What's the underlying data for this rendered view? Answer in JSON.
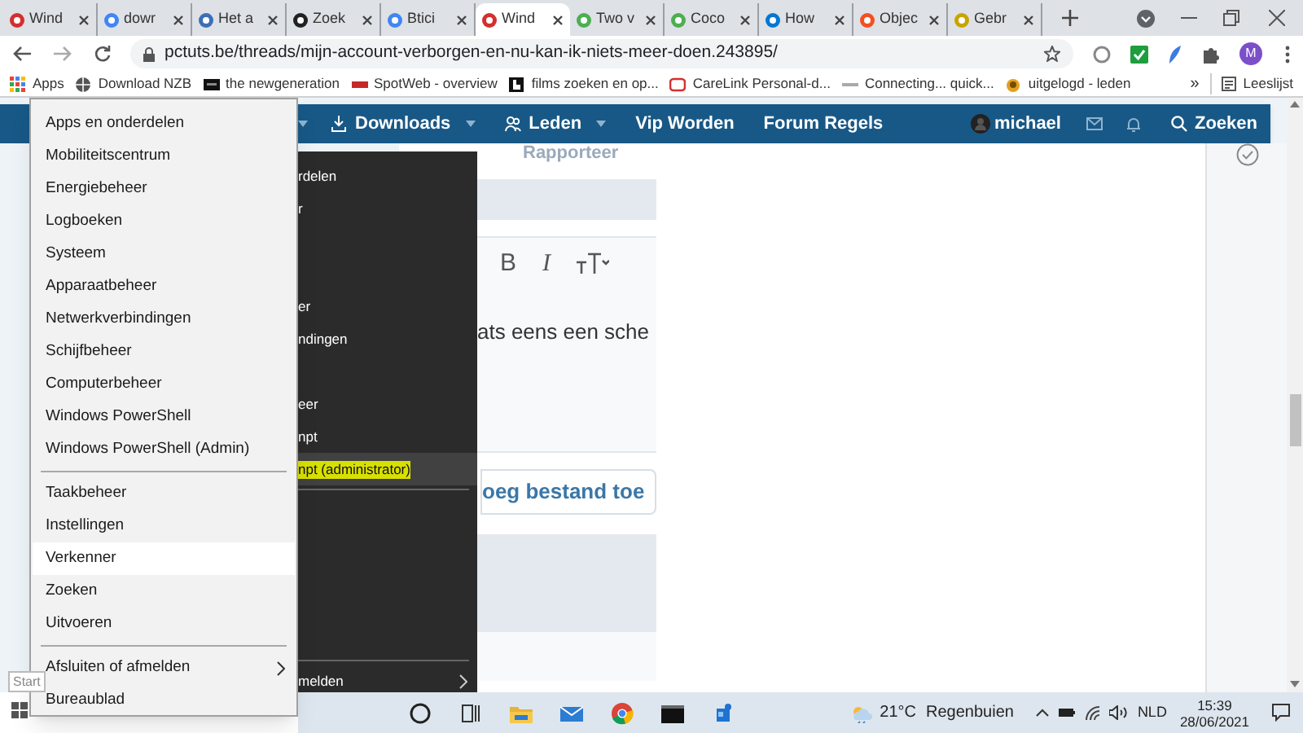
{
  "browser": {
    "tabs": [
      {
        "title": "Wind",
        "selected": false,
        "color": "#d32f2f"
      },
      {
        "title": "dowr",
        "selected": false,
        "color": "#4285f4"
      },
      {
        "title": "Het a",
        "selected": false,
        "color": "#3b6fb6"
      },
      {
        "title": "Zoek",
        "selected": false,
        "color": "#222222"
      },
      {
        "title": "Btici",
        "selected": false,
        "color": "#4285f4"
      },
      {
        "title": "Wind",
        "selected": true,
        "color": "#d32f2f"
      },
      {
        "title": "Two v",
        "selected": false,
        "color": "#4caf50"
      },
      {
        "title": "Coco",
        "selected": false,
        "color": "#4caf50"
      },
      {
        "title": "How",
        "selected": false,
        "color": "#0078d4"
      },
      {
        "title": "Objec",
        "selected": false,
        "color": "#f25022"
      },
      {
        "title": "Gebr",
        "selected": false,
        "color": "#c8a400"
      }
    ],
    "url": "pctuts.be/threads/mijn-account-verborgen-en-nu-kan-ik-niets-meer-doen.243895/",
    "profile_initial": "M",
    "bookmarks": [
      {
        "label": "Apps"
      },
      {
        "label": "Download NZB"
      },
      {
        "label": "the newgeneration"
      },
      {
        "label": "SpotWeb - overview"
      },
      {
        "label": "films zoeken en op..."
      },
      {
        "label": "CareLink Personal-d..."
      },
      {
        "label": "Connecting... quick..."
      },
      {
        "label": "uitgelogd - leden"
      }
    ],
    "bookmarks_overflow": "»",
    "reading_list": "Leeslijst"
  },
  "site_nav": {
    "items": [
      {
        "label": "Downloads",
        "dropdown": true
      },
      {
        "label": "Leden",
        "dropdown": true
      },
      {
        "label": "Vip Worden",
        "dropdown": false
      },
      {
        "label": "Forum Regels",
        "dropdown": false
      }
    ],
    "user": "michael",
    "search": "Zoeken"
  },
  "page": {
    "heading_fragment": "Rapporteer",
    "editor_buttons": [
      "B",
      "I"
    ],
    "editor_text": "ats eens een sche",
    "attach_button": "oeg bestand toe"
  },
  "context_menu": {
    "groups": [
      [
        {
          "label": "Apps en onderdelen",
          "selected": false,
          "submenu": false
        },
        {
          "label": "Mobiliteitscentrum",
          "selected": false,
          "submenu": false
        },
        {
          "label": "Energiebeheer",
          "selected": false,
          "submenu": false
        },
        {
          "label": "Logboeken",
          "selected": false,
          "submenu": false
        },
        {
          "label": "Systeem",
          "selected": false,
          "submenu": false
        },
        {
          "label": "Apparaatbeheer",
          "selected": false,
          "submenu": false
        },
        {
          "label": "Netwerkverbindingen",
          "selected": false,
          "submenu": false
        },
        {
          "label": "Schijfbeheer",
          "selected": false,
          "submenu": false
        },
        {
          "label": "Computerbeheer",
          "selected": false,
          "submenu": false
        },
        {
          "label": "Windows PowerShell",
          "selected": false,
          "submenu": false
        },
        {
          "label": "Windows PowerShell (Admin)",
          "selected": false,
          "submenu": false
        }
      ],
      [
        {
          "label": "Taakbeheer",
          "selected": false,
          "submenu": false
        },
        {
          "label": "Instellingen",
          "selected": false,
          "submenu": false
        },
        {
          "label": "Verkenner",
          "selected": true,
          "submenu": false
        },
        {
          "label": "Zoeken",
          "selected": false,
          "submenu": false
        },
        {
          "label": "Uitvoeren",
          "selected": false,
          "submenu": false
        }
      ],
      [
        {
          "label": "Afsluiten of afmelden",
          "selected": false,
          "submenu": true
        },
        {
          "label": "Bureaublad",
          "selected": false,
          "submenu": false
        }
      ]
    ]
  },
  "dark_menu": {
    "groups": [
      [
        {
          "kind": "text",
          "label": "rdelen",
          "highlighted": false
        },
        {
          "kind": "text",
          "label": "r",
          "highlighted": false
        },
        {
          "kind": "blank"
        },
        {
          "kind": "blank"
        },
        {
          "kind": "text",
          "label": "er",
          "highlighted": false
        },
        {
          "kind": "text",
          "label": "ndingen",
          "highlighted": false
        },
        {
          "kind": "blank"
        },
        {
          "kind": "text",
          "label": "eer",
          "highlighted": false
        },
        {
          "kind": "text",
          "label": "npt",
          "highlighted": false
        },
        {
          "kind": "text",
          "label": "npt (administrator)",
          "highlighted": true
        }
      ],
      [
        {
          "kind": "blank"
        },
        {
          "kind": "blank"
        },
        {
          "kind": "blank"
        },
        {
          "kind": "blank"
        },
        {
          "kind": "blank"
        }
      ],
      [
        {
          "kind": "submenu",
          "label": "melden",
          "highlighted": false
        }
      ]
    ]
  },
  "taskbar": {
    "tooltip": "Start",
    "weather": {
      "temperature": "21°C",
      "condition": "Regenbuien"
    },
    "language": "NLD",
    "time": "15:39",
    "date": "28/06/2021"
  }
}
